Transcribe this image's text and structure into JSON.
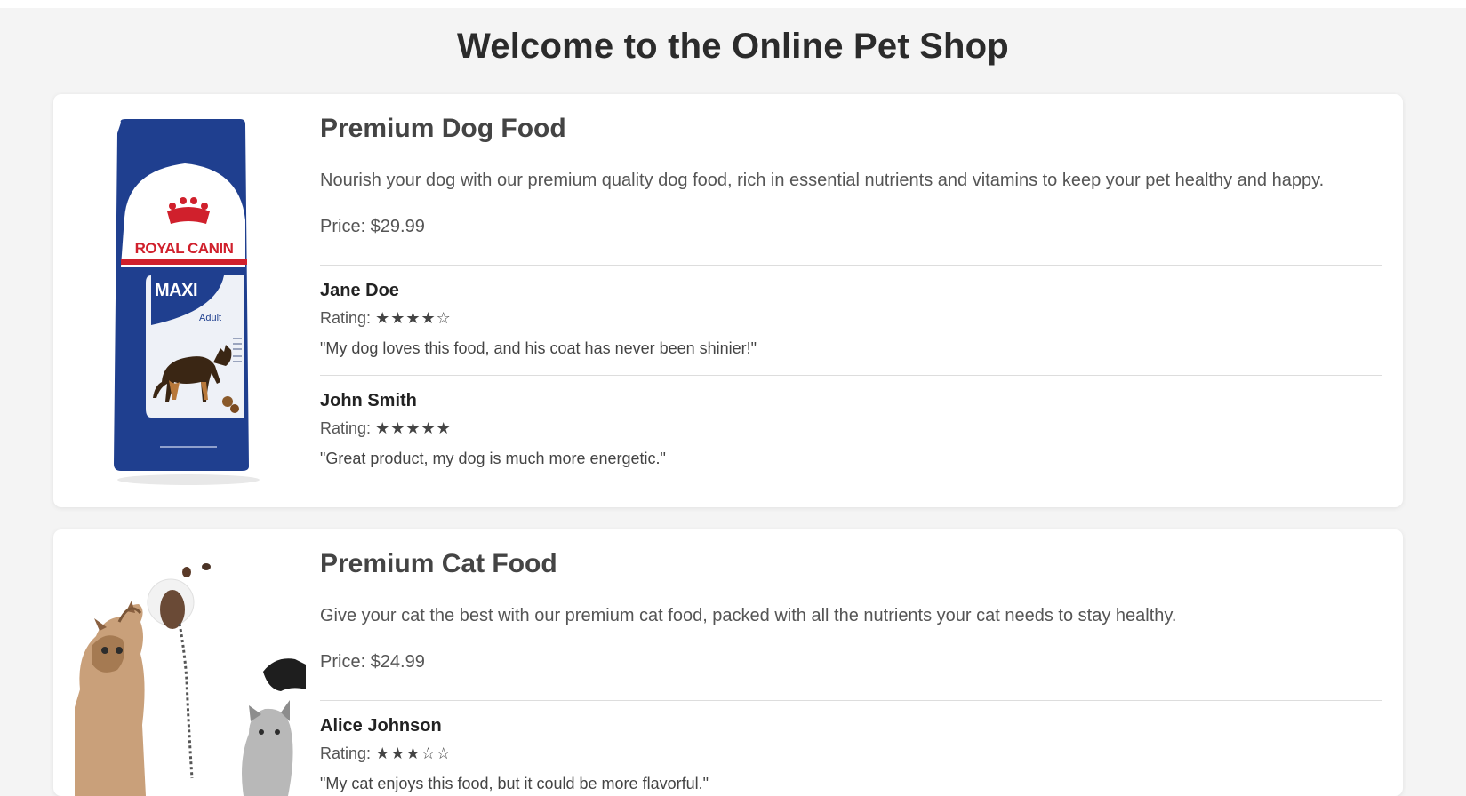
{
  "page": {
    "title": "Welcome to the Online Pet Shop"
  },
  "products": [
    {
      "name": "Premium Dog Food",
      "description": "Nourish your dog with our premium quality dog food, rich in essential nutrients and vitamins to keep your pet healthy and happy.",
      "price": "Price: $29.99",
      "image": {
        "brand_text": "ROYAL CANIN",
        "size_text": "MAXI",
        "age_text": "Adult"
      },
      "reviews": [
        {
          "name": "Jane Doe",
          "rating_label": "Rating:",
          "stars": "★★★★☆",
          "rating": 4,
          "text": "\"My dog loves this food, and his coat has never been shinier!\""
        },
        {
          "name": "John Smith",
          "rating_label": "Rating:",
          "stars": "★★★★★",
          "rating": 5,
          "text": "\"Great product, my dog is much more energetic.\""
        }
      ]
    },
    {
      "name": "Premium Cat Food",
      "description": "Give your cat the best with our premium cat food, packed with all the nutrients your cat needs to stay healthy.",
      "price": "Price: $24.99",
      "reviews": [
        {
          "name": "Alice Johnson",
          "rating_label": "Rating:",
          "stars": "★★★☆☆",
          "rating": 3,
          "text": "\"My cat enjoys this food, but it could be more flavorful.\""
        }
      ]
    }
  ],
  "colors": {
    "page_bg": "#f4f4f4",
    "card_bg": "#ffffff",
    "bag_blue": "#1f3f8f",
    "brand_red": "#d0202c"
  }
}
